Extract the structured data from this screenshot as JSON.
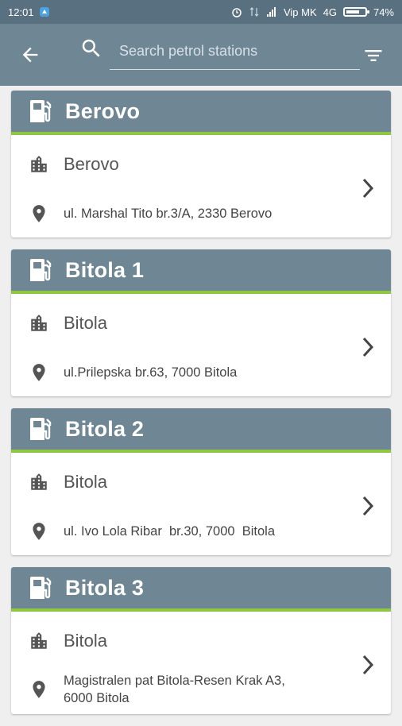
{
  "status_bar": {
    "time": "12:01",
    "carrier": "Vip MK",
    "network": "4G",
    "battery_percent": "74%",
    "battery_level": 0.74
  },
  "toolbar": {
    "search_placeholder": "Search petrol stations"
  },
  "stations": [
    {
      "name": "Berovo",
      "city": "Berovo",
      "address": "ul. Marshal Tito br.3/A, 2330 Berovo"
    },
    {
      "name": "Bitola 1",
      "city": "Bitola",
      "address": "ul.Prilepska br.63, 7000 Bitola"
    },
    {
      "name": "Bitola 2",
      "city": "Bitola",
      "address": "ul. Ivo Lola Ribar  br.30, 7000  Bitola"
    },
    {
      "name": "Bitola 3",
      "city": "Bitola",
      "address": "Magistralen pat Bitola-Resen Krak A3, 6000 Bitola"
    }
  ],
  "colors": {
    "header": "#6f8795",
    "status_bar": "#587080",
    "accent_line": "#8dc63f",
    "background": "#efefef"
  }
}
